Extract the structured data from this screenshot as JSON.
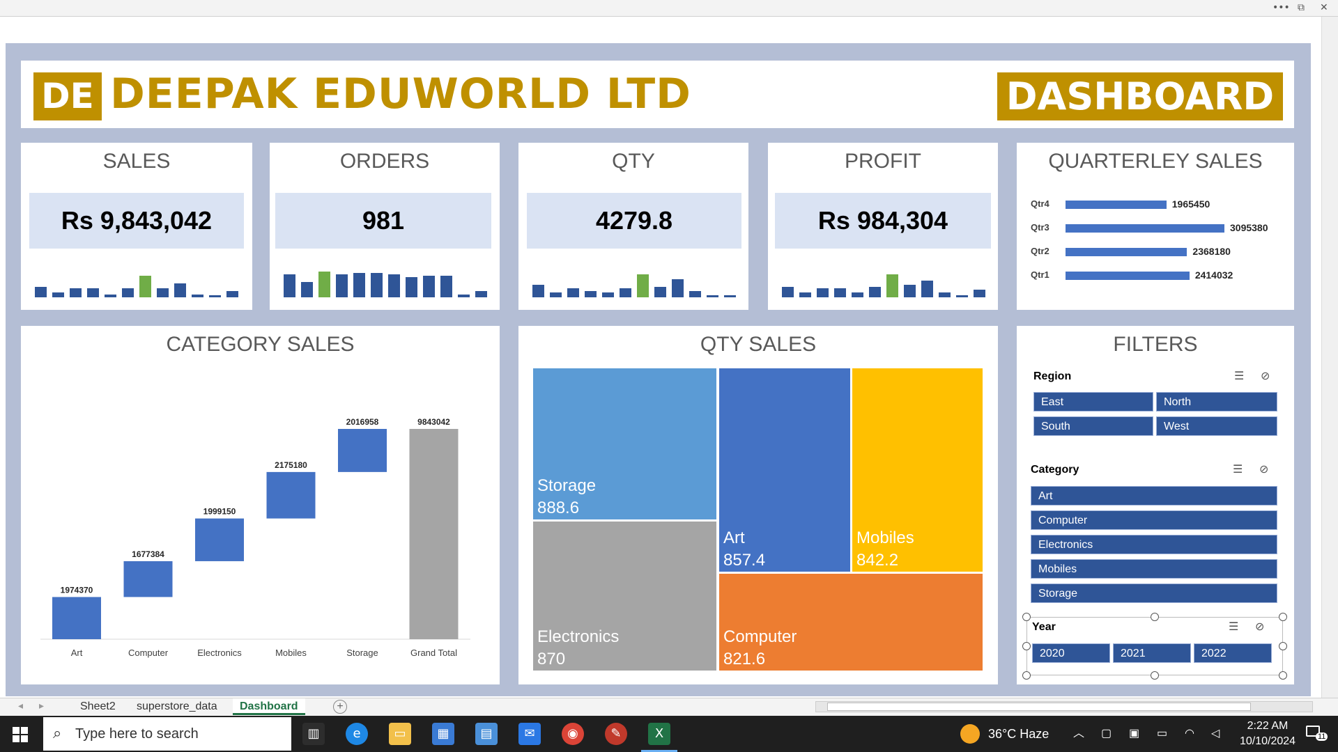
{
  "window": {
    "more": "•••",
    "restore": "⧉",
    "close": "✕"
  },
  "header": {
    "logo": "DE",
    "company": "DEEPAK EDUWORLD LTD",
    "dashboard": "DASHBOARD"
  },
  "kpis": [
    {
      "title": "SALES",
      "value": "Rs 9,843,042",
      "spark": [
        0.35,
        0.15,
        0.3,
        0.3,
        0.1,
        0.3,
        0.7,
        0.3,
        0.45,
        0.1,
        0.05,
        0.2
      ],
      "hi": 6
    },
    {
      "title": "ORDERS",
      "value": "981",
      "spark": [
        0.75,
        0.5,
        0.85,
        0.75,
        0.8,
        0.8,
        0.75,
        0.65,
        0.7,
        0.7,
        0.1,
        0.2
      ],
      "hi": 2
    },
    {
      "title": "QTY",
      "value": "4279.8",
      "spark": [
        0.4,
        0.15,
        0.3,
        0.2,
        0.15,
        0.3,
        0.75,
        0.35,
        0.6,
        0.2,
        0.05,
        0.05
      ],
      "hi": 6
    },
    {
      "title": "PROFIT",
      "value": "Rs 984,304",
      "spark": [
        0.35,
        0.15,
        0.3,
        0.3,
        0.15,
        0.35,
        0.75,
        0.4,
        0.55,
        0.15,
        0.05,
        0.25
      ],
      "hi": 6
    }
  ],
  "quarterly": {
    "title": "QUARTERLEY SALES",
    "chart_data": {
      "type": "bar",
      "orientation": "horizontal",
      "categories": [
        "Qtr4",
        "Qtr3",
        "Qtr2",
        "Qtr1"
      ],
      "values": [
        1965450,
        3095380,
        2368180,
        2414032
      ],
      "labels": [
        "1965450",
        "3095380",
        "2368180",
        "2414032"
      ]
    }
  },
  "category": {
    "title": "CATEGORY SALES",
    "chart_data": {
      "type": "waterfall",
      "categories": [
        "Art",
        "Computer",
        "Electronics",
        "Mobiles",
        "Storage",
        "Grand Total"
      ],
      "values": [
        1974370,
        1677384,
        1999150,
        2175180,
        2016958,
        9843042
      ],
      "labels": [
        "1974370",
        "1677384",
        "1999150",
        "2175180",
        "2016958",
        "9843042"
      ],
      "colors": {
        "bar": "#4472c4",
        "total": "#a5a5a5"
      }
    }
  },
  "qty": {
    "title": "QTY SALES",
    "chart_data": {
      "type": "treemap",
      "items": [
        {
          "name": "Storage",
          "value": "888.6",
          "color": "#5b9bd5"
        },
        {
          "name": "Electronics",
          "value": "870",
          "color": "#a5a5a5"
        },
        {
          "name": "Art",
          "value": "857.4",
          "color": "#4472c4"
        },
        {
          "name": "Mobiles",
          "value": "842.2",
          "color": "#ffc000"
        },
        {
          "name": "Computer",
          "value": "821.6",
          "color": "#ed7d31"
        }
      ]
    }
  },
  "filters": {
    "title": "FILTERS",
    "region": {
      "label": "Region",
      "items": [
        "East",
        "North",
        "South",
        "West"
      ]
    },
    "category": {
      "label": "Category",
      "items": [
        "Art",
        "Computer",
        "Electronics",
        "Mobiles",
        "Storage"
      ]
    },
    "year": {
      "label": "Year",
      "items": [
        "2020",
        "2021",
        "2022"
      ]
    },
    "multi_select_icon": "☰",
    "clear_icon": "⊘"
  },
  "tabs": {
    "nav_left": "◂",
    "nav_right": "▸",
    "items": [
      "Sheet2",
      "superstore_data",
      "Dashboard"
    ],
    "active": "Dashboard",
    "add": "+"
  },
  "taskbar": {
    "search": "Type here to search",
    "weather": "36°C  Haze",
    "time": "2:22 AM",
    "date": "10/10/2024",
    "notifications": "11"
  }
}
